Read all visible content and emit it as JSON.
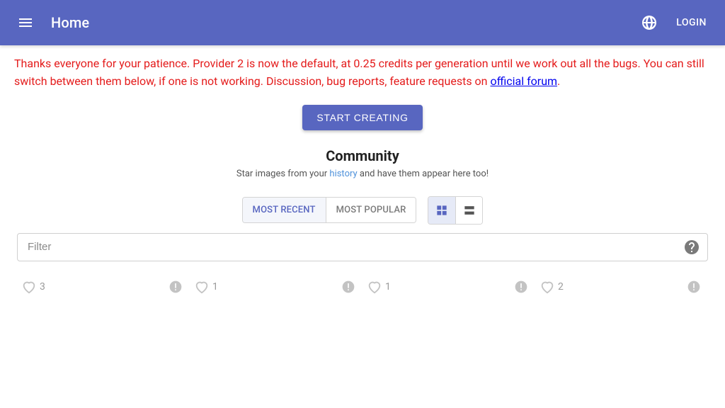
{
  "header": {
    "title": "Home",
    "login_label": "LOGIN"
  },
  "announcement": {
    "text_1": "Thanks everyone for your patience. Provider 2 is now the default, at 0.25 credits per generation until we work out all the bugs. You can still switch between them below, if one is not working. Discussion, bug reports, feature requests on ",
    "link_text": "official forum",
    "text_2": "."
  },
  "cta": {
    "label": "START CREATING"
  },
  "community": {
    "heading": "Community",
    "sub_1": "Star images from your ",
    "sub_link": "history",
    "sub_2": " and have them appear here too!"
  },
  "sort": {
    "recent": "MOST RECENT",
    "popular": "MOST POPULAR"
  },
  "filter": {
    "placeholder": "Filter"
  },
  "cards": [
    {
      "likes": "3"
    },
    {
      "likes": "1"
    },
    {
      "likes": "1"
    },
    {
      "likes": "2"
    }
  ],
  "colors": {
    "accent": "#5866c0",
    "danger": "#e41b1b"
  }
}
